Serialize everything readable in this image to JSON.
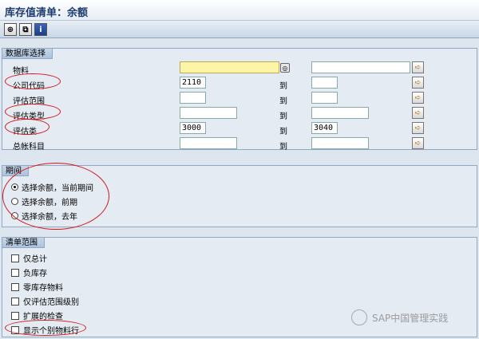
{
  "window": {
    "title": "库存值清单：余额"
  },
  "toolbar": {
    "buttons": [
      "execute-icon",
      "variant-icon",
      "info-icon"
    ]
  },
  "db_selection": {
    "title": "数据库选择",
    "rows": [
      {
        "label": "物料",
        "from": "",
        "to_label": "",
        "to": ""
      },
      {
        "label": "公司代码",
        "from": "2110",
        "to_label": "到",
        "to": ""
      },
      {
        "label": "评估范围",
        "from": "",
        "to_label": "到",
        "to": ""
      },
      {
        "label": "评估类型",
        "from": "",
        "to_label": "到",
        "to": ""
      },
      {
        "label": "评估类",
        "from": "3000",
        "to_label": "到",
        "to": "3040"
      },
      {
        "label": "总帐科目",
        "from": "",
        "to_label": "到",
        "to": ""
      }
    ]
  },
  "period": {
    "title": "期间",
    "options": [
      {
        "label": "选择余额，当前期间",
        "selected": true
      },
      {
        "label": "选择余额，前期",
        "selected": false
      },
      {
        "label": "选择余额，去年",
        "selected": false
      }
    ]
  },
  "list_scope": {
    "title": "清单范围",
    "options": [
      {
        "label": "仅总计",
        "checked": false
      },
      {
        "label": "负库存",
        "checked": false
      },
      {
        "label": "零库存物料",
        "checked": false
      },
      {
        "label": "仅评估范围级别",
        "checked": false
      },
      {
        "label": "扩展的检查",
        "checked": false
      },
      {
        "label": "显示个别物料行",
        "checked": false
      }
    ]
  },
  "watermark": {
    "text": "SAP中国管理实践"
  },
  "colors": {
    "annotation": "#d21a1a",
    "required_field": "#fdf5a6"
  }
}
